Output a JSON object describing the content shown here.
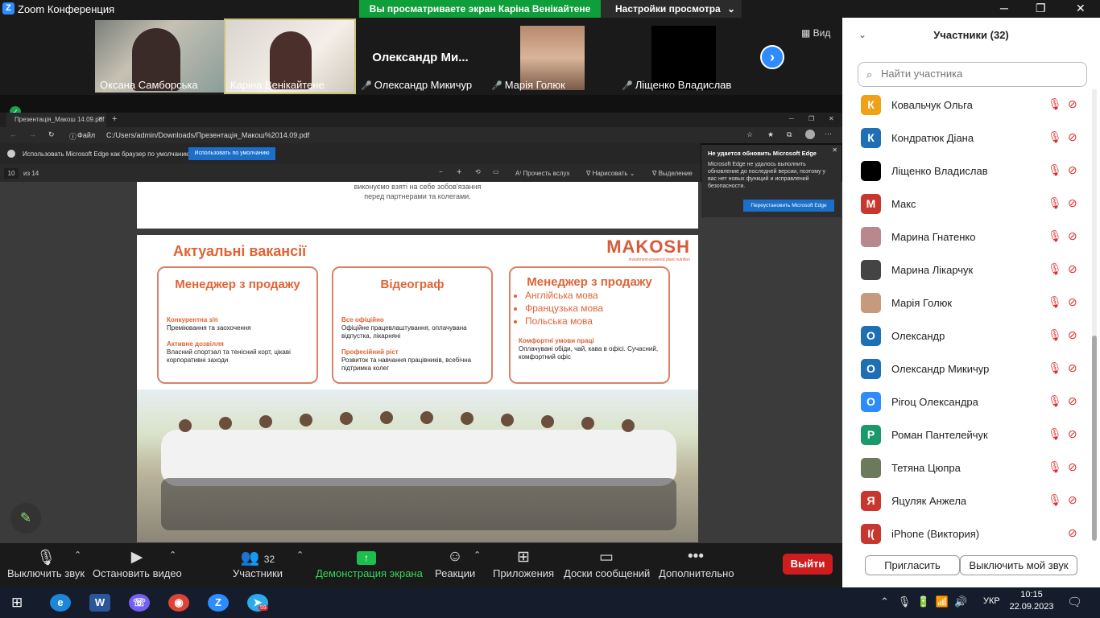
{
  "app": {
    "title": "Zoom Конференция"
  },
  "share_banner": {
    "viewing": "Вы просматриваете экран Каріна Венікайтене",
    "settings": "Настройки просмотра"
  },
  "video_strip": {
    "view_label": "Вид",
    "tiles": [
      {
        "name": "Оксана Самборська",
        "muted": false
      },
      {
        "name": "Каріна Венікайтене",
        "muted": false
      },
      {
        "name": "Олександр Микичур",
        "muted": true,
        "big_name": "Олександр  Ми..."
      },
      {
        "name": "Марія Голюк",
        "muted": true
      },
      {
        "name": "Ліщенко Владислав",
        "muted": true
      }
    ]
  },
  "browser": {
    "tab_title": "Презентація_Макош 14.09.pdf",
    "address_prefix": "Файл",
    "address": "C:/Users/admin/Downloads/Презентація_Макош%2014.09.pdf",
    "infobar_text": "Использовать Microsoft Edge как браузер по умолчанию?",
    "infobar_button": "Использовать по умолчанию",
    "pdf_page": "10",
    "pdf_of": "из 14",
    "pdf_read_aloud": "Прочесть вслух",
    "pdf_draw": "Нарисовать",
    "pdf_highlight": "Выделение",
    "notification": {
      "title": "Не удается обновить Microsoft Edge",
      "body": "Microsoft Edge не удалось выполнить обновление до последней версии, поэтому у вас нет новых функций и исправлений безопасности.",
      "button": "Переустановить Microsoft Edge"
    }
  },
  "slide": {
    "prev_text": "виконуємо взяті на себе зобов'язання перед партнерами та колегами.",
    "heading": "Актуальні вакансії",
    "brand": "MAKOSH",
    "brand_tag": "investment-powered plant nutrition",
    "cards": [
      {
        "title": "Менеджер з продажу",
        "s1_title": "Конкурентна з/п",
        "s1_text": "Преміювання та заохочення",
        "s2_title": "Активне дозвілля",
        "s2_text": "Власний спортзал та тенісний корт, цікаві корпоративні заходи"
      },
      {
        "title": "Відеограф",
        "s1_title": "Все офіційно",
        "s1_text": "Офіційне працевлаштування, оплачувана відпустка, лікарняні",
        "s2_title": "Професійний ріст",
        "s2_text": "Розвиток та навчання працівників, всебічна підтримка колег"
      },
      {
        "title": "Менеджер з продажу",
        "languages": [
          "Англійська мова",
          "Французька мова",
          "Польська мова"
        ],
        "s1_title": "Комфортні умови праці",
        "s1_text": "Оплачувані обіди, чай, кава в офісі. Сучасний, комфортний офіс"
      }
    ]
  },
  "toolbar": {
    "mute": "Выключить звук",
    "video": "Остановить видео",
    "participants": "Участники",
    "participants_count": "32",
    "share": "Демонстрация экрана",
    "reactions": "Реакции",
    "apps": "Приложения",
    "whiteboards": "Доски сообщений",
    "more": "Дополнительно",
    "leave": "Выйти"
  },
  "panel": {
    "title": "Участники (32)",
    "search_placeholder": "Найти участника",
    "participants": [
      {
        "name": "Ковальчук Ольга",
        "initial": "К",
        "color": "#f0a117"
      },
      {
        "name": "Кондратюк Діана",
        "initial": "К",
        "color": "#1f6fb5"
      },
      {
        "name": "Ліщенко Владислав",
        "initial": "",
        "color": "#000000"
      },
      {
        "name": "Макс",
        "initial": "М",
        "color": "#c8372d"
      },
      {
        "name": "Марина Гнатенко",
        "initial": "",
        "color": "#b9888f"
      },
      {
        "name": "Марина Лікарчук",
        "initial": "",
        "color": "#444444"
      },
      {
        "name": "Марія Голюк",
        "initial": "",
        "color": "#c69a7c"
      },
      {
        "name": "Олександр",
        "initial": "О",
        "color": "#1f6fb5"
      },
      {
        "name": "Олександр Микичур",
        "initial": "О",
        "color": "#1f6fb5"
      },
      {
        "name": "Рігоц Олександра",
        "initial": "О",
        "color": "#2d8cff"
      },
      {
        "name": "Роман Пантелейчук",
        "initial": "Р",
        "color": "#1a9a6a"
      },
      {
        "name": "Тетяна Цюпра",
        "initial": "",
        "color": "#6c7a5c"
      },
      {
        "name": "Яцуляк Анжела",
        "initial": "Я",
        "color": "#c8372d"
      },
      {
        "name": "iPhone (Виктория)",
        "initial": "I(",
        "color": "#c8372d"
      }
    ],
    "invite": "Пригласить",
    "mute_me": "Выключить мой звук"
  },
  "taskbar": {
    "time": "10:15",
    "date": "22.09.2023",
    "lang": "УКР",
    "telegram_badge": "59"
  }
}
